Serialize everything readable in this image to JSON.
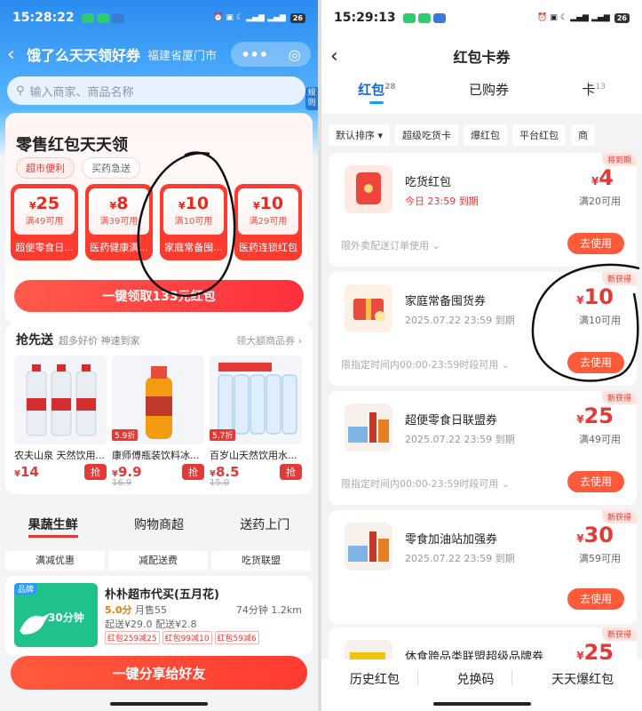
{
  "left": {
    "status": {
      "time": "15:28:22",
      "battery": "26"
    },
    "title": "饿了么天天领好券",
    "location": "福建省厦门市",
    "capsule": {
      "more": "•••",
      "close": "◎"
    },
    "search_placeholder": "输入商家、商品名称",
    "rules": "规则",
    "promo": {
      "title": "零售红包天天领",
      "tabs": [
        "超市便利",
        "买药急送"
      ],
      "coupons": [
        {
          "value": "25",
          "cond": "满49可用",
          "name": "超便零食日..."
        },
        {
          "value": "8",
          "cond": "满39可用",
          "name": "医药健康满..."
        },
        {
          "value": "10",
          "cond": "满10可用",
          "name": "家庭常备囤..."
        },
        {
          "value": "10",
          "cond": "满29可用",
          "name": "医药连锁红包"
        }
      ],
      "currency": "¥",
      "claim_button": "一键领取133元红包"
    },
    "grab": {
      "title": "抢先送",
      "subtitle": "超多好价 神速到家",
      "more": "领大额商品券 ›",
      "grab_label": "抢",
      "products": [
        {
          "name": "农夫山泉 天然饮用...",
          "price": "14",
          "old": "",
          "discount": ""
        },
        {
          "name": "康师傅瓶装饮料冰...",
          "price": "9.9",
          "old": "16.9",
          "discount": "5.9折"
        },
        {
          "name": "百岁山天然饮用水...",
          "price": "8.5",
          "old": "15.0",
          "discount": "5.7折"
        }
      ]
    },
    "categories": [
      "果蔬生鲜",
      "购物商超",
      "送药上门"
    ],
    "subtabs": [
      "满减优惠",
      "减配送费",
      "吃货联盟"
    ],
    "store": {
      "tag": "品牌",
      "minutes": "30分钟",
      "name": "朴朴超市代买(五月花)",
      "rating": "5.0分",
      "sales": "月售55",
      "time_dist": "74分钟 1.2km",
      "fees": "起送¥29.0 配送¥2.8",
      "deals": [
        "红包259减25",
        "红包99减10",
        "红包59减6"
      ]
    },
    "share_button": "一键分享给好友"
  },
  "right": {
    "status": {
      "time": "15:29:13",
      "battery": "26"
    },
    "title": "红包卡券",
    "tabs": [
      {
        "label": "红包",
        "count": "28"
      },
      {
        "label": "已购券",
        "count": ""
      },
      {
        "label": "卡",
        "count": "13"
      }
    ],
    "chips": [
      "默认排序 ▾",
      "超级吃货卡",
      "爆红包",
      "平台红包",
      "商"
    ],
    "use_label": "去使用",
    "cards": [
      {
        "name": "吃货红包",
        "expiry": "今日 23:59 到期",
        "badge": "将到期",
        "amount": "4",
        "cond": "满20可用",
        "note": "限外卖配送订单使用 ⌄"
      },
      {
        "name": "家庭常备囤货券",
        "expiry": "2025.07.22 23:59 到期",
        "badge": "新获得",
        "amount": "10",
        "cond": "满10可用",
        "note": "限指定时间内00:00-23:59时段可用 ⌄"
      },
      {
        "name": "超便零食日联盟券",
        "expiry": "2025.07.22 23:59 到期",
        "badge": "新获得",
        "amount": "25",
        "cond": "满49可用",
        "note": "限指定时间内00:00-23:59时段可用 ⌄"
      },
      {
        "name": "零食加油站加强券",
        "expiry": "2025.07.22 23:59 到期",
        "badge": "新获得",
        "amount": "30",
        "cond": "满59可用",
        "note": "限指定时间内00:00-23:59时段可用 ⌄"
      },
      {
        "name": "休食跨品类联盟超级品牌券",
        "expiry": "",
        "badge": "新获得",
        "amount": "25",
        "cond": "",
        "note": ""
      }
    ],
    "bottom": [
      "历史红包",
      "兑换码",
      "天天爆红包"
    ]
  }
}
